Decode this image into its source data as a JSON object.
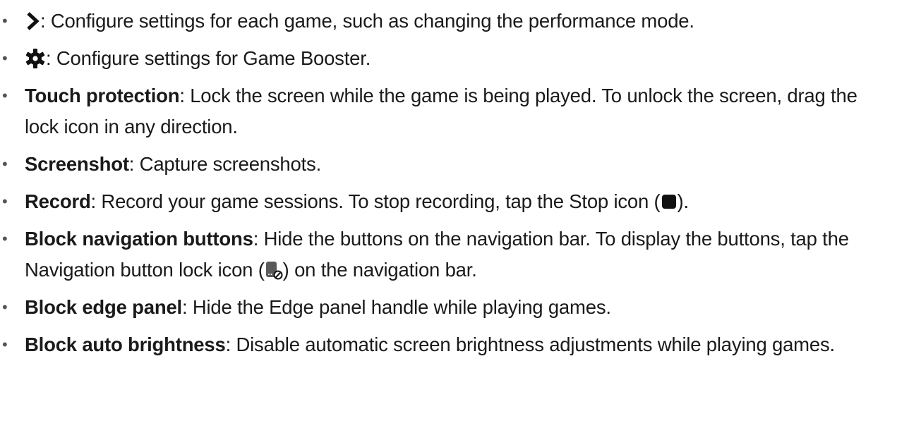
{
  "items": [
    {
      "icon": "chevron-right-icon",
      "term": "",
      "text": ": Configure settings for each game, such as changing the performance mode."
    },
    {
      "icon": "gear-icon",
      "term": "",
      "text": ": Configure settings for Game Booster."
    },
    {
      "term": "Touch protection",
      "text": ": Lock the screen while the game is being played. To unlock the screen, drag the lock icon in any direction."
    },
    {
      "term": "Screenshot",
      "text": ": Capture screenshots."
    },
    {
      "term": "Record",
      "text_before": ": Record your game sessions. To stop recording, tap the Stop icon (",
      "inline_icon": "stop-icon",
      "text_after": ")."
    },
    {
      "term": "Block navigation buttons",
      "text_before": ": Hide the buttons on the navigation bar. To display the buttons, tap the Navigation button lock icon (",
      "inline_icon": "navigation-button-lock-icon",
      "text_after": ") on the navigation bar."
    },
    {
      "term": "Block edge panel",
      "text": ": Hide the Edge panel handle while playing games."
    },
    {
      "term": "Block auto brightness",
      "text": ": Disable automatic screen brightness adjustments while playing games."
    }
  ],
  "bullet_char": "•",
  "colors": {
    "text": "#1a1a1a",
    "bullet": "#555555"
  }
}
